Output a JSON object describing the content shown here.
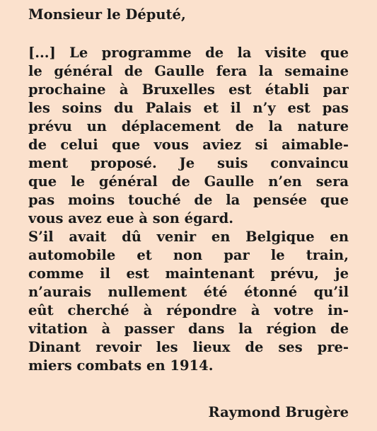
{
  "letter": {
    "salutation": "Monsieur le Député,",
    "lines": [
      "[...] Le programme de la visite que",
      "le général de Gaulle fera la semaine",
      "prochaine à Bruxelles est établi par",
      "les soins du Palais et il n’y est pas",
      "prévu un déplacement de la nature",
      "de celui que vous aviez si aimable-",
      "ment proposé. Je suis convaincu",
      "que le général de Gaulle n’en sera",
      "pas moins touché de la pensée que",
      "vous avez eue à son égard.",
      "S’il avait dû venir en Belgique en",
      "automobile et non par le train,",
      "comme il est maintenant prévu, je",
      "n’aurais nullement été étonné qu’il",
      "eût cherché à répondre à votre in-",
      "vitation à passer dans la région de",
      "Dinant revoir les lieux de ses pre-",
      "miers combats en 1914."
    ],
    "signature": "Raymond Brugère"
  }
}
